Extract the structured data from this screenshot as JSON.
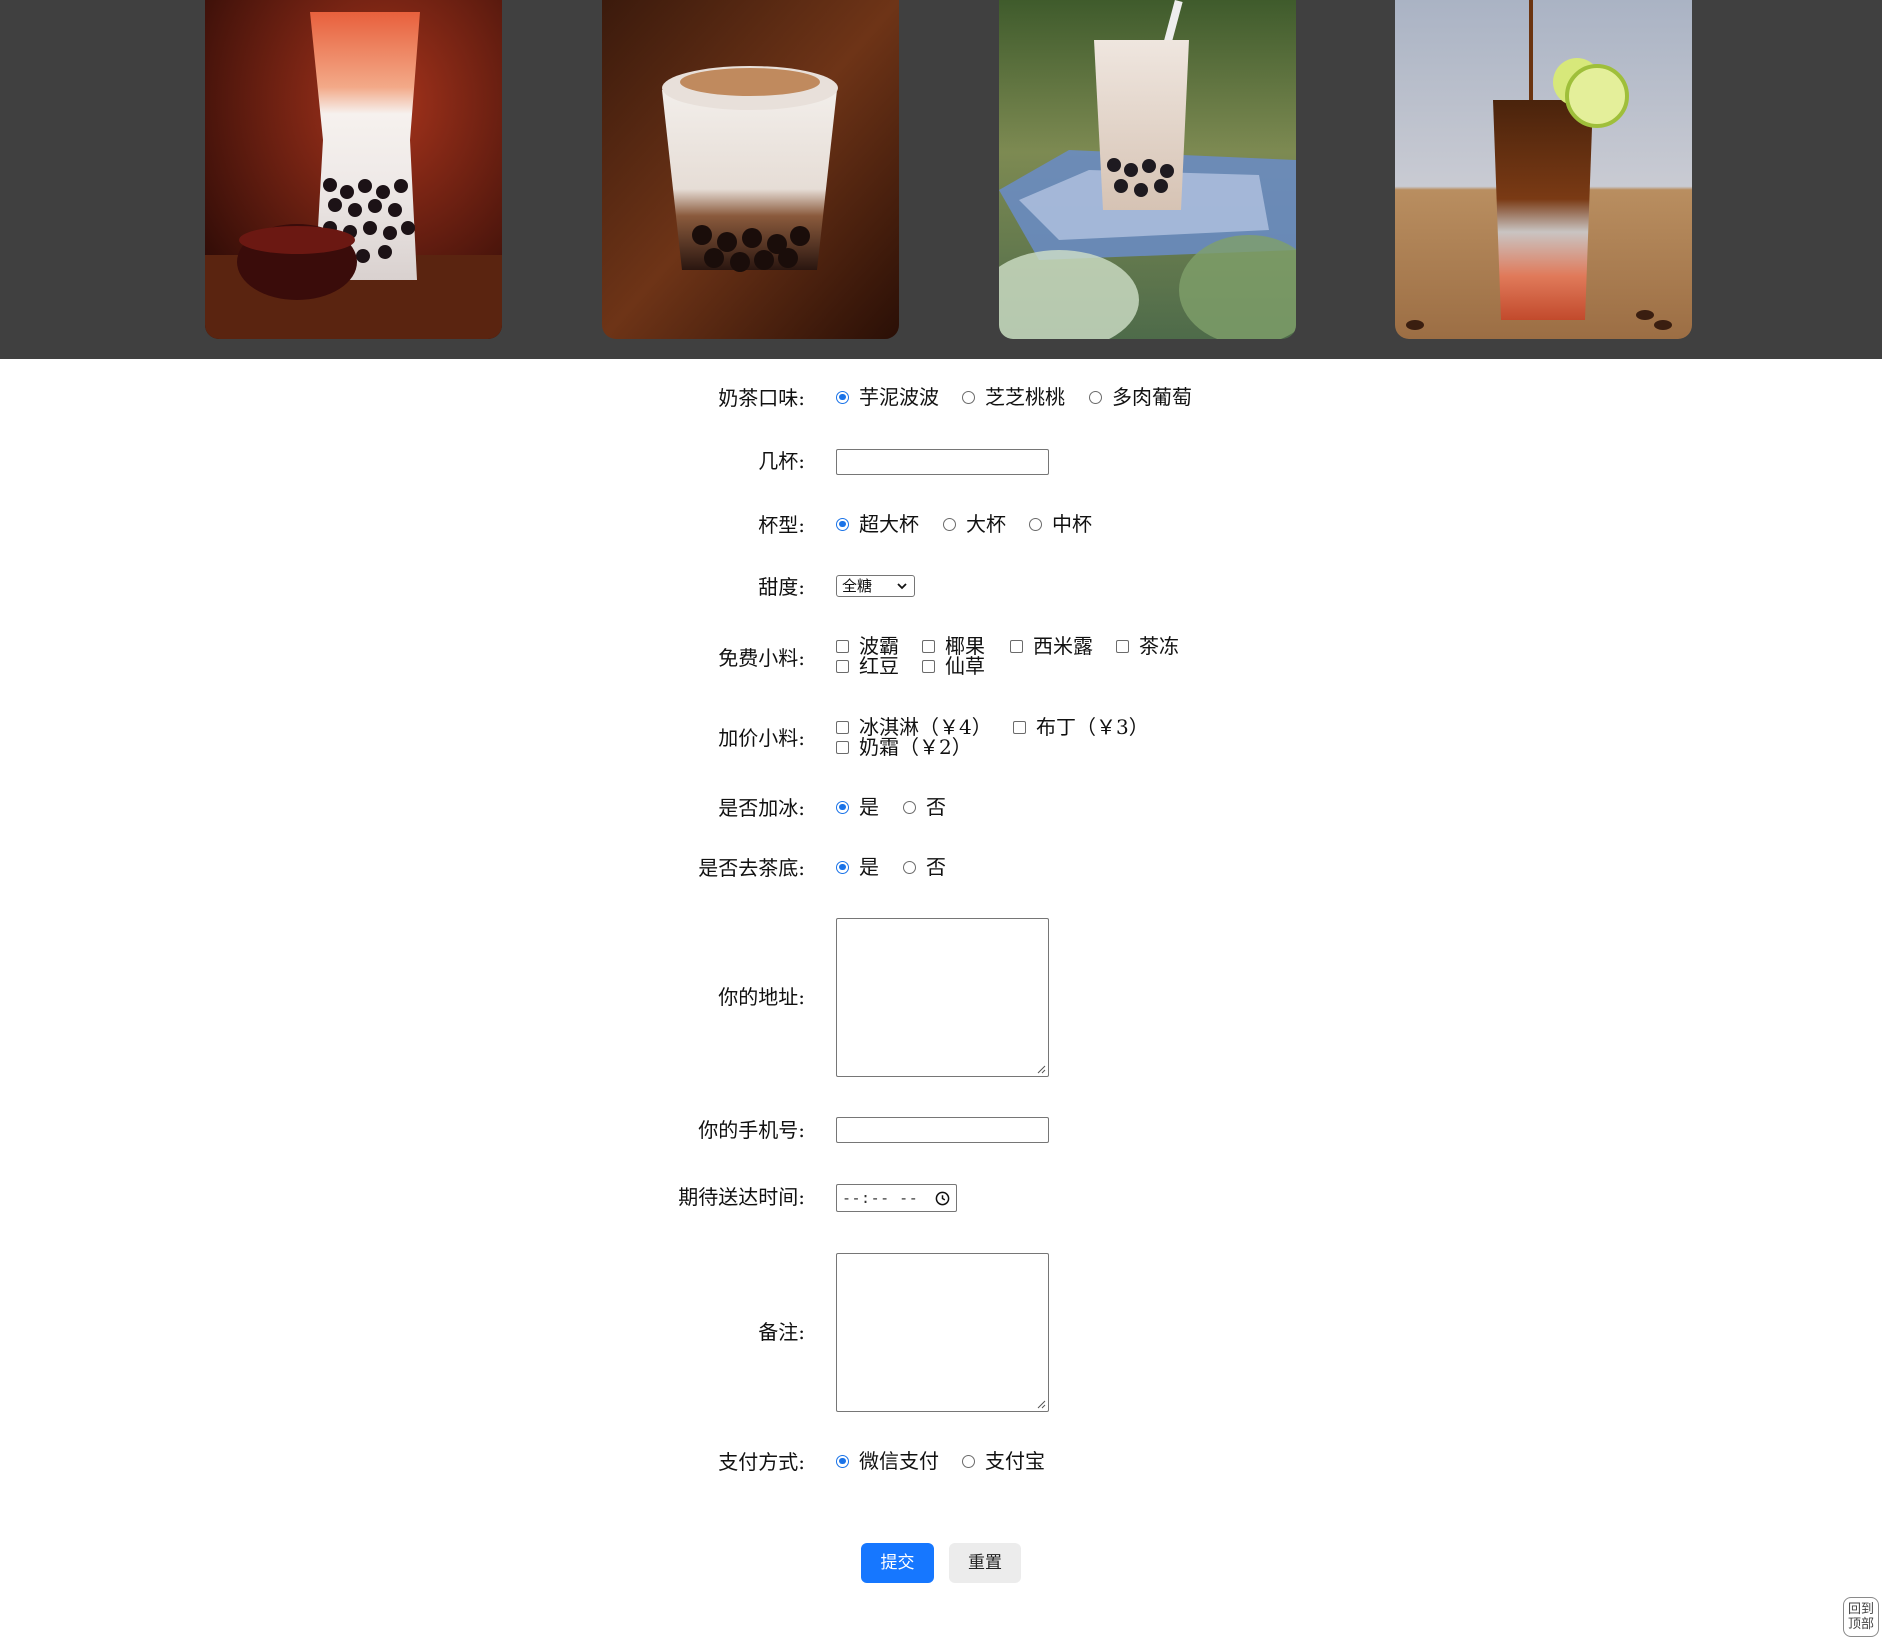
{
  "form": {
    "flavor": {
      "label": "奶茶口味:",
      "options": [
        "芋泥波波",
        "芝芝桃桃",
        "多肉葡萄"
      ]
    },
    "cups": {
      "label": "几杯:",
      "value": ""
    },
    "size": {
      "label": "杯型:",
      "options": [
        "超大杯",
        "大杯",
        "中杯"
      ]
    },
    "sweetness": {
      "label": "甜度:",
      "selected": "全糖"
    },
    "free_toppings": {
      "label": "免费小料:",
      "options": [
        "波霸",
        "椰果",
        "西米露",
        "茶冻",
        "红豆",
        "仙草"
      ]
    },
    "paid_toppings": {
      "label": "加价小料:",
      "options": [
        "冰淇淋（￥4）",
        "布丁（￥3）",
        "奶霜（￥2）"
      ]
    },
    "ice": {
      "label": "是否加冰:",
      "options": [
        "是",
        "否"
      ]
    },
    "tea_base": {
      "label": "是否去茶底:",
      "options": [
        "是",
        "否"
      ]
    },
    "address": {
      "label": "你的地址:",
      "value": ""
    },
    "phone": {
      "label": "你的手机号:",
      "value": ""
    },
    "delivery_time": {
      "label": "期待送达时间:",
      "value": "--:-- --"
    },
    "notes": {
      "label": "备注:",
      "value": ""
    },
    "payment": {
      "label": "支付方式:",
      "options": [
        "微信支付",
        "支付宝"
      ]
    }
  },
  "buttons": {
    "submit": "提交",
    "reset": "重置"
  },
  "back_to_top": {
    "line1": "回到",
    "line2": "顶部"
  },
  "colors": {
    "banner": "#404040",
    "accent": "#1677ff",
    "radio_checked": "#1a73e8"
  }
}
